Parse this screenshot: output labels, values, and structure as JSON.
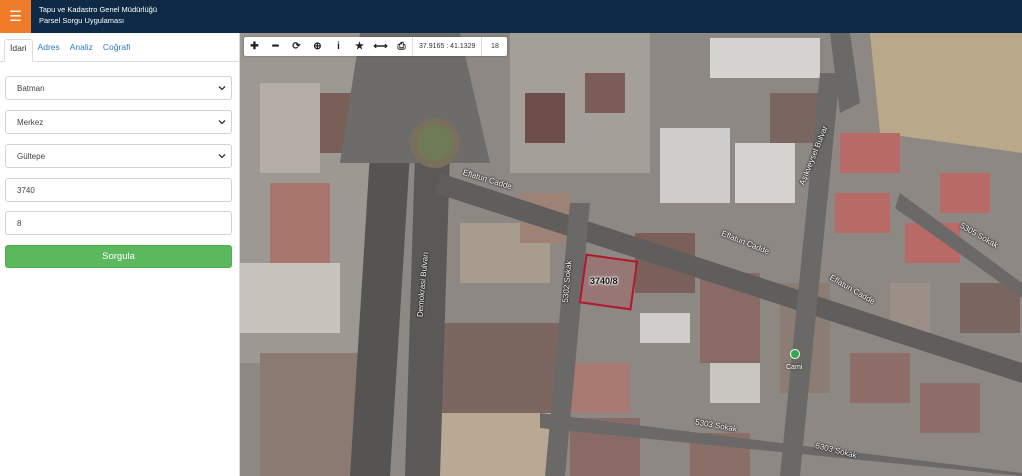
{
  "header": {
    "title_line1": "Tapu ve Kadastro Genel Müdürlüğü",
    "title_line2": "Parsel Sorgu Uygulaması",
    "menu_icon": "hamburger-icon",
    "colors": {
      "bar": "#0e2a47",
      "menu": "#f07c2a"
    }
  },
  "sidebar": {
    "tabs": [
      {
        "label": "İdari",
        "active": true
      },
      {
        "label": "Adres",
        "active": false
      },
      {
        "label": "Analiz",
        "active": false
      },
      {
        "label": "Coğrafi",
        "active": false
      }
    ],
    "province": "Batman",
    "district": "Merkez",
    "neighborhood": "Gültepe",
    "block": "3740",
    "parcel": "8",
    "submit_label": "Sorgula",
    "submit_color": "#5cb85c"
  },
  "map": {
    "toolbar": {
      "buttons": [
        "plus-icon",
        "minus-icon",
        "refresh-icon",
        "locate-icon",
        "info-icon",
        "star-icon",
        "measure-icon",
        "print-icon"
      ],
      "coords": "37.9165 : 41.1329",
      "zoom": "18"
    },
    "parcel_label": "3740/8",
    "roads": {
      "eflatun1": "Eflatun Cadde",
      "eflatun2": "Eflatun Cadde",
      "eflatun3": "Eflatun Cadde",
      "demokrasi": "Demokrasi Bulvarı",
      "s5302": "5302 Sokak",
      "s5303a": "5303 Sokak",
      "s5303b": "5303 Sokak",
      "s5305": "5305 Sokak",
      "asikveysel": "Aşıkveysel Bulvar"
    },
    "poi_label": "Cami"
  }
}
